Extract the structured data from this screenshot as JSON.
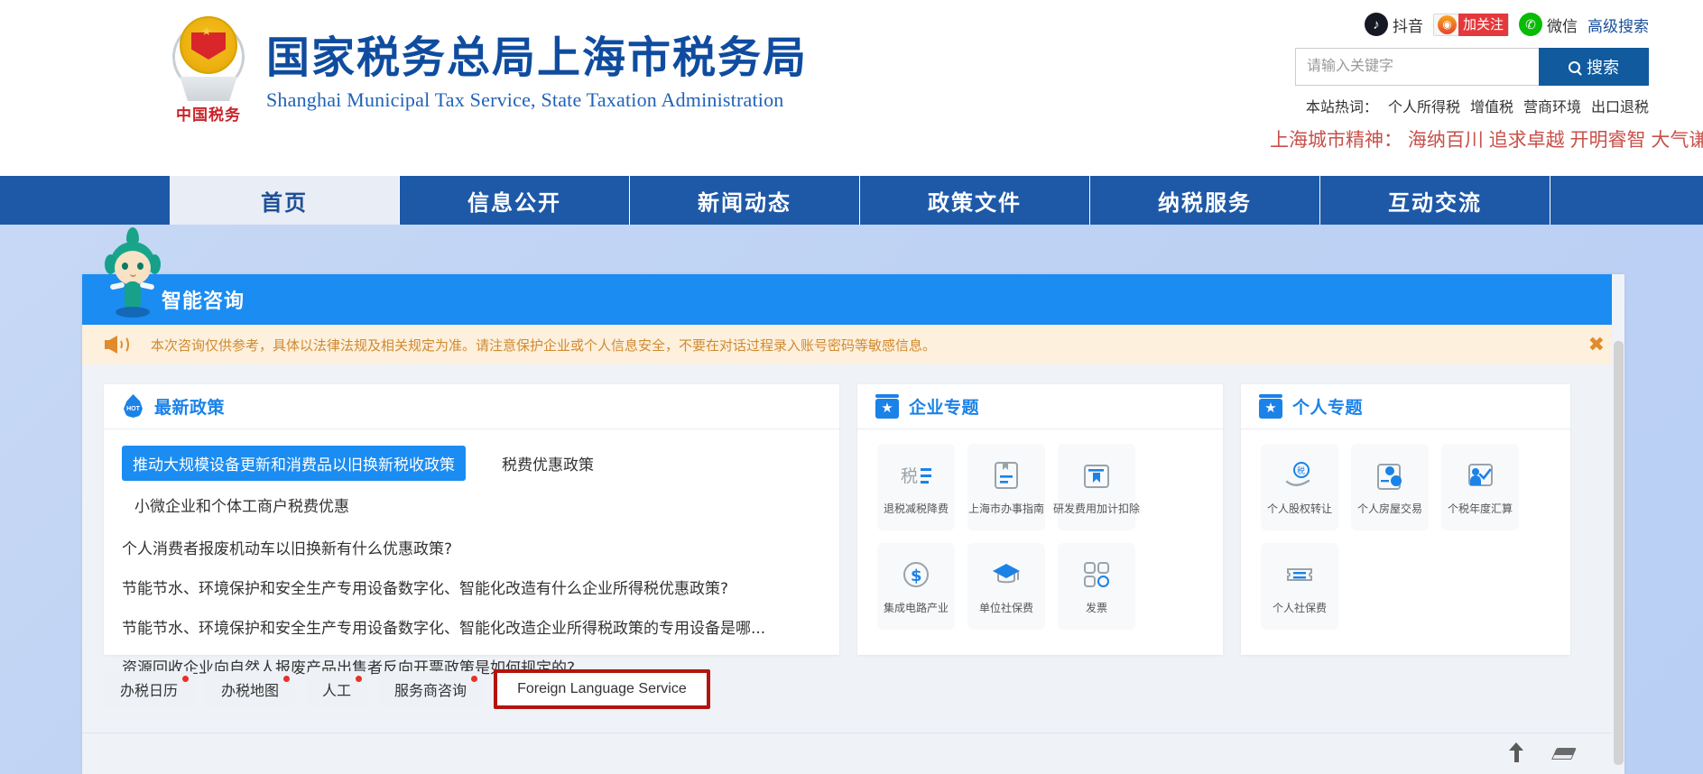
{
  "header": {
    "emblem_text": "中国税务",
    "site_name_cn": "国家税务总局上海市税务局",
    "site_name_en": "Shanghai Municipal Tax Service, State Taxation Administration",
    "social": [
      {
        "icon": "douyin-icon",
        "label": "抖音"
      },
      {
        "icon": "weibo-icon",
        "label": "加关注"
      },
      {
        "icon": "wechat-icon",
        "label": "微信"
      }
    ],
    "advanced_search": "高级搜索",
    "search": {
      "placeholder": "请输入关键字",
      "value": "",
      "button_label": "搜索",
      "button_icon": "search-icon"
    },
    "hotwords_label": "本站热词：",
    "hotwords": [
      "个人所得税",
      "增值税",
      "营商环境",
      "出口退税"
    ],
    "slogan": "上海城市精神： 海纳百川 追求卓越 开明睿智 大气谦和",
    "slogan_color": "#c8504a"
  },
  "nav": {
    "items": [
      {
        "label": "首页",
        "active": true
      },
      {
        "label": "信息公开",
        "active": false
      },
      {
        "label": "新闻动态",
        "active": false
      },
      {
        "label": "政策文件",
        "active": false
      },
      {
        "label": "纳税服务",
        "active": false
      },
      {
        "label": "互动交流",
        "active": false
      }
    ],
    "bg_color": "#1e59a8",
    "active_bg": "#e9edf5"
  },
  "chat": {
    "title": "智能咨询",
    "title_bar_color": "#1b8cf2",
    "mascot": "tax-mascot",
    "notice": {
      "icon": "speaker-icon",
      "text": "本次咨询仅供参考，具体以法律法规及相关规定为准。请注意保护企业或个人信息安全，不要在对话过程录入账号密码等敏感信息。",
      "close_icon": "close-icon",
      "bg_color": "#fdf0dc",
      "text_color": "#d08a33"
    }
  },
  "policy_card": {
    "icon": "hot-icon",
    "title": "最新政策",
    "tabs": [
      {
        "label": "推动大规模设备更新和消费品以旧换新税收政策",
        "active": true
      },
      {
        "label": "税费优惠政策",
        "active": false
      }
    ],
    "subtab": "小微企业和个体工商户税费优惠",
    "items": [
      "个人消费者报废机动车以旧换新有什么优惠政策?",
      "节能节水、环境保护和安全生产专用设备数字化、智能化改造有什么企业所得税优惠政策?",
      "节能节水、环境保护和安全生产专用设备数字化、智能化改造企业所得税政策的专用设备是哪...",
      "资源回收企业向自然人报废产品出售者反向开票政策是如何规定的?"
    ]
  },
  "enterprise_card": {
    "icon": "star-icon",
    "title": "企业专题",
    "tiles": [
      {
        "icon": "tax-reduction-icon",
        "label": "退税减税降费"
      },
      {
        "icon": "guide-document-icon",
        "label": "上海市办事指南"
      },
      {
        "icon": "rnd-deduction-icon",
        "label": "研发费用加计扣除"
      },
      {
        "icon": "dollar-circle-icon",
        "label": "集成电路产业"
      },
      {
        "icon": "graduation-cap-icon",
        "label": "单位社保费"
      },
      {
        "icon": "grid-invoice-icon",
        "label": "发票"
      }
    ]
  },
  "personal_card": {
    "icon": "star-icon",
    "title": "个人专题",
    "tiles": [
      {
        "icon": "equity-transfer-icon",
        "label": "个人股权转让"
      },
      {
        "icon": "house-trade-icon",
        "label": "个人房屋交易"
      },
      {
        "icon": "annual-settlement-icon",
        "label": "个税年度汇算"
      },
      {
        "icon": "social-insurance-icon",
        "label": "个人社保费"
      }
    ]
  },
  "quick_buttons": [
    {
      "label": "办税日历",
      "badge": true,
      "highlighted": false
    },
    {
      "label": "办税地图",
      "badge": true,
      "highlighted": false
    },
    {
      "label": "人工",
      "badge": true,
      "highlighted": false
    },
    {
      "label": "服务商咨询",
      "badge": true,
      "highlighted": false
    },
    {
      "label": "Foreign Language Service",
      "badge": false,
      "highlighted": true
    }
  ],
  "highlight_color": "#b3140f",
  "footer_tools": [
    {
      "icon": "send-up-icon"
    },
    {
      "icon": "eraser-icon"
    }
  ]
}
